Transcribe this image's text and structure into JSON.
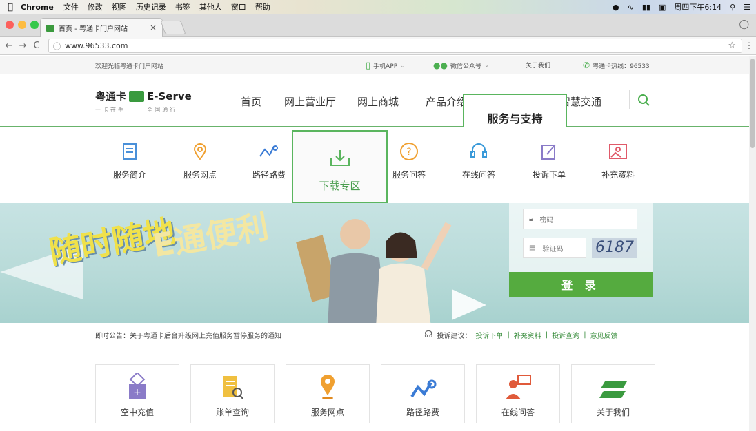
{
  "menubar": {
    "app": "Chrome",
    "menus": [
      "文件",
      "修改",
      "视图",
      "历史记录",
      "书签",
      "其他人",
      "窗口",
      "帮助"
    ],
    "clock": "周四下午6:14"
  },
  "browser": {
    "tab_title": "首页 - 粤通卡门户网站",
    "url": "www.96533.com"
  },
  "topstrip": {
    "welcome": "欢迎光临粤通卡门户网站",
    "app": "手机APP",
    "wechat": "微信公众号",
    "about": "关于我们",
    "hotline": "粤通卡热线：96533"
  },
  "logo": {
    "name": "粤通卡",
    "brand": "E-Serve",
    "slogan_left": "一卡在手",
    "slogan_right": "全国通行"
  },
  "nav": {
    "items": [
      "首页",
      "网上营业厅",
      "网上商城",
      "产品介绍",
      "服务与支持",
      "智慧交通"
    ]
  },
  "submenu": {
    "items": [
      "服务简介",
      "服务网点",
      "路径路费",
      "下载专区",
      "服务问答",
      "在线问答",
      "投诉下单",
      "补充资料"
    ]
  },
  "banner": {
    "slogan1": "随时随地",
    "slogan2": "E通便利"
  },
  "login": {
    "password_placeholder": "密码",
    "captcha_placeholder": "验证码",
    "captcha_code": "6187",
    "button": "登 录"
  },
  "notice": {
    "text": "即时公告：关于粤通卡后台升级网上充值服务暂停服务的通知",
    "advice_label": "投诉建议：",
    "links": [
      "投诉下单",
      "补充资料",
      "投诉查询",
      "意见反馈"
    ]
  },
  "quick": {
    "items": [
      "空中充值",
      "账单查询",
      "服务网点",
      "路径路费",
      "在线问答",
      "关于我们"
    ]
  },
  "colors": {
    "brand_green": "#5ab55e",
    "login_green": "#55ab3f"
  }
}
